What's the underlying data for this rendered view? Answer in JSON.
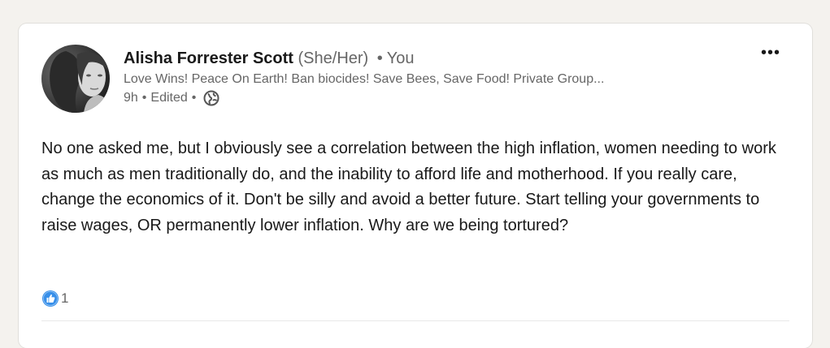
{
  "post": {
    "author": {
      "name": "Alisha Forrester Scott",
      "pronouns": "(She/Her)",
      "separator": "•",
      "relation": "You",
      "headline": "Love Wins! Peace On Earth! Ban biocides! Save Bees, Save Food! Private Group..."
    },
    "meta": {
      "time": "9h",
      "edited": "Edited",
      "separator": "•",
      "visibility_icon": "globe-icon"
    },
    "more_label": "•••",
    "text": "No one asked me, but I obviously see a correlation between the high inflation, women needing to work as much as men traditionally do, and the inability to afford life and motherhood. If you really care, change the economics of it. Don't be silly and avoid a better future. Start telling your governments to raise wages, OR permanently lower inflation. Why are we being tortured?",
    "reactions": {
      "icon": "like-icon",
      "count": "1"
    }
  },
  "colors": {
    "background": "#f4f2ee",
    "card": "#ffffff",
    "text_primary": "#191919",
    "text_secondary": "#666666",
    "like_blue": "#378fe9"
  }
}
